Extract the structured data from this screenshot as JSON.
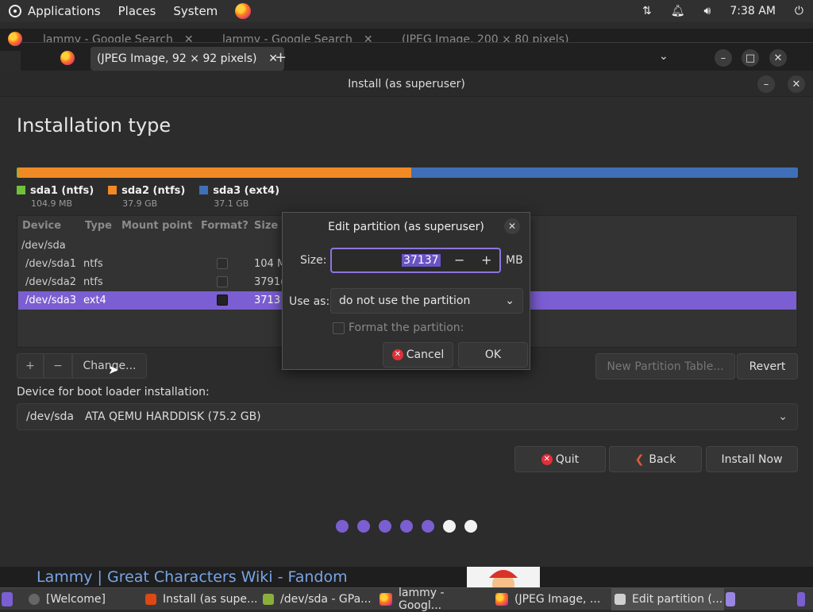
{
  "top_panel": {
    "menus": [
      "Applications",
      "Places",
      "System"
    ],
    "clock": "7:38 AM"
  },
  "bg_tabs": [
    "lammy - Google Search",
    "lammy - Google Search",
    "(JPEG Image, 200 × 80 pixels)"
  ],
  "firefox": {
    "active_tab": "(JPEG Image, 92 × 92 pixels)",
    "new_tab": "+"
  },
  "installer": {
    "window_title": "Install (as superuser)",
    "page_title": "Installation type",
    "partitions": [
      {
        "name": "sda1 (ntfs)",
        "size": "104.9 MB",
        "color": "#6fc03a"
      },
      {
        "name": "sda2 (ntfs)",
        "size": "37.9 GB",
        "color": "#f08a24"
      },
      {
        "name": "sda3 (ext4)",
        "size": "37.1 GB",
        "color": "#3f6fb8"
      }
    ],
    "table": {
      "headers": [
        "Device",
        "Type",
        "Mount point",
        "Format?",
        "Size"
      ],
      "disk": "/dev/sda",
      "rows": [
        {
          "device": "/dev/sda1",
          "type": "ntfs",
          "size": "104 M"
        },
        {
          "device": "/dev/sda2",
          "type": "ntfs",
          "size": "3791("
        },
        {
          "device": "/dev/sda3",
          "type": "ext4",
          "size": "3713"
        }
      ]
    },
    "buttons": {
      "add": "+",
      "remove": "−",
      "change": "Change...",
      "new_table": "New Partition Table...",
      "revert": "Revert",
      "quit": "Quit",
      "back": "Back",
      "install": "Install Now"
    },
    "boot_label": "Device for boot loader installation:",
    "boot_device": "/dev/sda",
    "boot_desc": "ATA QEMU HARDDISK (75.2 GB)"
  },
  "dialog": {
    "title": "Edit partition (as superuser)",
    "size_label": "Size:",
    "size_value": "37137",
    "size_unit": "MB",
    "use_as_label": "Use as:",
    "use_as_value": "do not use the partition",
    "format_label": "Format the partition:",
    "cancel": "Cancel",
    "ok": "OK"
  },
  "wiki_title": "Lammy | Great Characters Wiki - Fandom",
  "taskbar": [
    "[Welcome]",
    "Install (as supe...",
    "/dev/sda - GPa...",
    "lammy - Googl...",
    "(JPEG Image, ...",
    "Edit partition (..."
  ],
  "colors": {
    "accent": "#7b5ed1",
    "orange": "#f08a24",
    "blue": "#3f6fb8"
  }
}
